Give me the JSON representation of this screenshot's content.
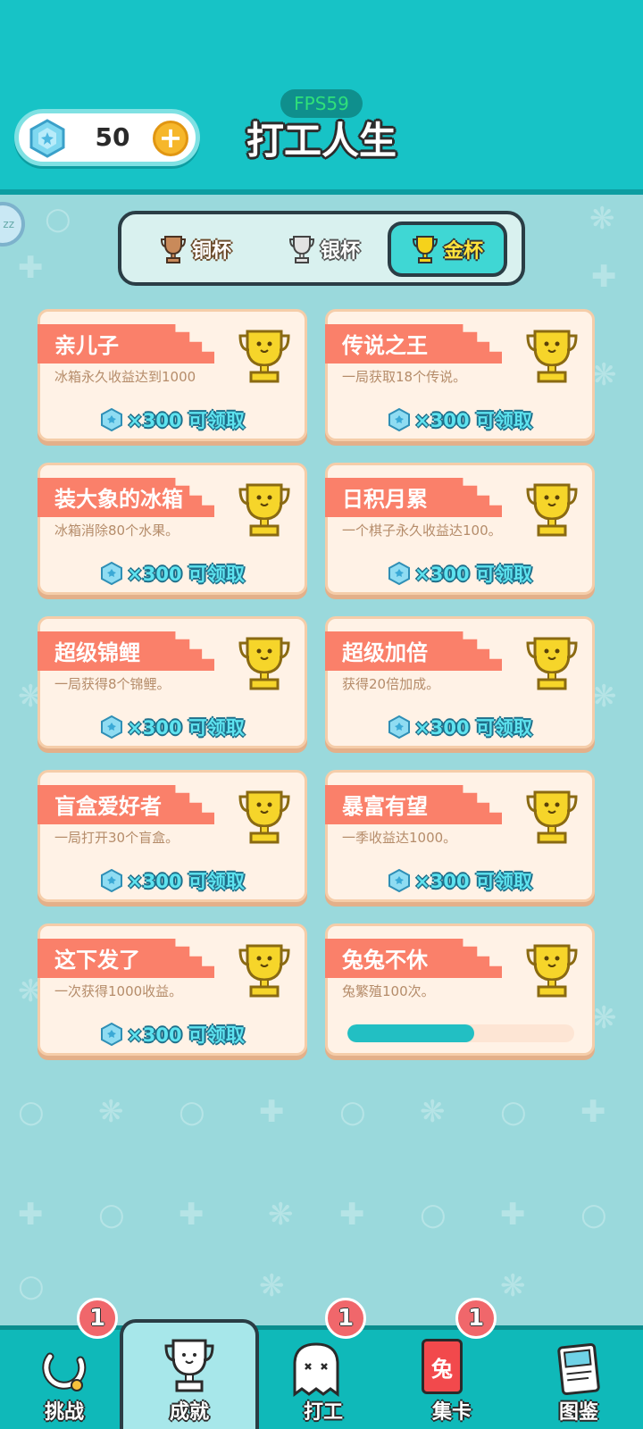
{
  "header": {
    "gem_count": "50",
    "fps": "FPS59",
    "title": "打工人生",
    "side_bubble": "zz"
  },
  "tabs": [
    {
      "label": "铜杯",
      "icon": "bronze-trophy-icon",
      "color": "#c98a5a"
    },
    {
      "label": "银杯",
      "icon": "silver-trophy-icon",
      "color": "#c8c8c8"
    },
    {
      "label": "金杯",
      "icon": "gold-trophy-icon",
      "color": "#f5d21b",
      "active": true
    }
  ],
  "cards": [
    {
      "title": "亲儿子",
      "desc": "冰箱永久收益达到1000",
      "reward": "×300 可领取"
    },
    {
      "title": "传说之王",
      "desc": "一局获取18个传说。",
      "reward": "×300 可领取"
    },
    {
      "title": "装大象的冰箱",
      "desc": "冰箱消除80个水果。",
      "reward": "×300 可领取"
    },
    {
      "title": "日积月累",
      "desc": "一个棋子永久收益达100。",
      "reward": "×300 可领取"
    },
    {
      "title": "超级锦鲤",
      "desc": "一局获得8个锦鲤。",
      "reward": "×300 可领取"
    },
    {
      "title": "超级加倍",
      "desc": "获得20倍加成。",
      "reward": "×300 可领取"
    },
    {
      "title": "盲盒爱好者",
      "desc": "一局打开30个盲盒。",
      "reward": "×300 可领取"
    },
    {
      "title": "暴富有望",
      "desc": "一季收益达1000。",
      "reward": "×300 可领取"
    },
    {
      "title": "这下发了",
      "desc": "一次获得1000收益。",
      "reward": "×300 可领取"
    },
    {
      "title": "兔兔不休",
      "desc": "兔繁殖100次。",
      "progress": 0.56
    }
  ],
  "nav": [
    {
      "label": "挑战",
      "icon": "challenge-icon",
      "badge": "1"
    },
    {
      "label": "成就",
      "icon": "trophy-icon",
      "active": true
    },
    {
      "label": "打工",
      "icon": "ghost-icon",
      "badge": "1"
    },
    {
      "label": "集卡",
      "icon": "card-icon",
      "badge": "1",
      "card_char": "兔"
    },
    {
      "label": "图鉴",
      "icon": "book-icon"
    }
  ],
  "colors": {
    "header": "#17c3c6",
    "background": "#9ad9dc",
    "ribbon": "#fa806a",
    "card": "#fff2e6",
    "progress": "#22bfc3"
  }
}
